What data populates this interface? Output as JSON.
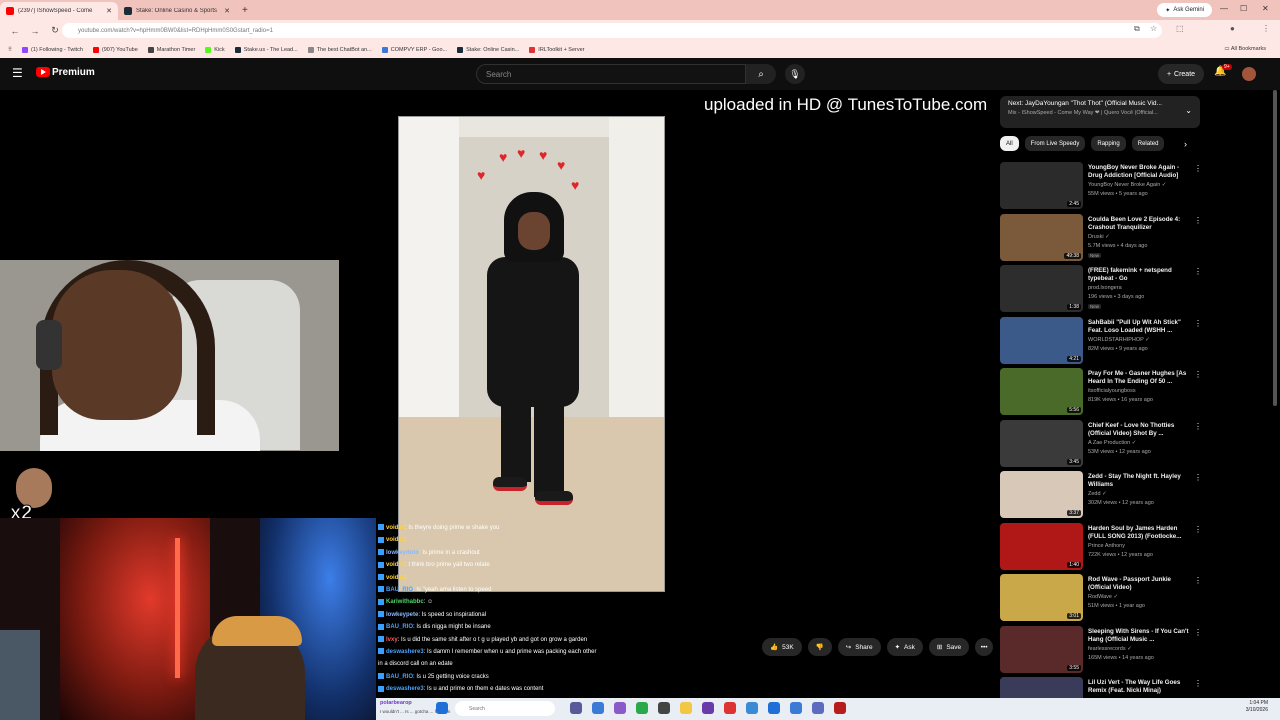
{
  "browser": {
    "tabs": [
      {
        "label": "(2397) IShowSpeed - Come",
        "active": true
      },
      {
        "label": "Stake: Online Casino & Sports",
        "active": false
      }
    ],
    "new_tab": "+",
    "ask_gemini": "Ask Gemini",
    "url": "youtube.com/watch?v=hpHmm0BW0&list=RDHpHmm0S0Gstart_radio=1",
    "bookmarks": [
      "(1) Following - Twitch",
      "(907) YouTube",
      "Marathon Timer",
      "Kick",
      "Stake.us - The Lead...",
      "The best ChatBot an...",
      "COMPVY ERP - Goo...",
      "Stake: Online Casin...",
      "IRLToolkit + Server"
    ],
    "all_bookmarks": "All Bookmarks"
  },
  "youtube": {
    "brand": "Premium",
    "search_placeholder": "Search",
    "create": "Create",
    "notifications": "9+"
  },
  "video": {
    "watermark": "uploaded in HD @ TunesToTube.com"
  },
  "actions": {
    "likes": "53K",
    "share": "Share",
    "ask": "Ask",
    "save": "Save",
    "more": "•••"
  },
  "upnext": {
    "title": "Next: JayDaYoungan \"Thot Thot\" (Official Music Vid...",
    "subtitle": "Mix - IShowSpeed - Come My Way ❤ | Quero Você (Official..."
  },
  "chips": [
    "All",
    "From Live Speedy",
    "Rapping",
    "Related"
  ],
  "recommendations": [
    {
      "title": "YoungBoy Never Broke Again - Drug Addiction [Official Audio]",
      "channel": "YoungBoy Never Broke Again ✓",
      "meta": "55M views • 5 years ago",
      "duration": "2:45",
      "new": ""
    },
    {
      "title": "Coulda Been Love 2 Episode 4: Crashout Tranquilizer",
      "channel": "Druski ✓",
      "meta": "5.7M views • 4 days ago",
      "duration": "49:38",
      "new": "New"
    },
    {
      "title": "(FREE) fakemink + netspend typebeat - Go",
      "channel": "prod.lxongera",
      "meta": "196 views • 3 days ago",
      "duration": "1:38",
      "new": "New"
    },
    {
      "title": "SahBabii \"Pull Up Wit Ah Stick\" Feat. Loso Loaded (WSHH ...",
      "channel": "WORLDSTARHIPHOP ✓",
      "meta": "82M views • 9 years ago",
      "duration": "4:21",
      "new": ""
    },
    {
      "title": "Pray For Me - Gasner Hughes [As Heard In The Ending Of 50 ...",
      "channel": "itsofficialyoungboss",
      "meta": "819K views • 16 years ago",
      "duration": "5:56",
      "new": ""
    },
    {
      "title": "Chief Keef - Love No Thotties (Official Video) Shot By ...",
      "channel": "A Zae Production ✓",
      "meta": "53M views • 12 years ago",
      "duration": "3:45",
      "new": ""
    },
    {
      "title": "Zedd - Stay The Night ft. Hayley Williams",
      "channel": "Zedd ✓",
      "meta": "302M views • 12 years ago",
      "duration": "3:37",
      "new": ""
    },
    {
      "title": "Harden Soul by James Harden (FULL SONG 2013) (Footlocke...",
      "channel": "Prince Anthony",
      "meta": "722K views • 12 years ago",
      "duration": "1:40",
      "new": ""
    },
    {
      "title": "Rod Wave - Passport Junkie (Official Video)",
      "channel": "RodWave ✓",
      "meta": "51M views • 1 year ago",
      "duration": "3:01",
      "new": ""
    },
    {
      "title": "Sleeping With Sirens - If You Can't Hang (Official Music ...",
      "channel": "fearlessrecords ✓",
      "meta": "165M views • 14 years ago",
      "duration": "3:55",
      "new": ""
    },
    {
      "title": "Lil Uzi Vert - The Way Life Goes Remix (Feat. Nicki Minaj)",
      "channel": "",
      "meta": "",
      "duration": "",
      "new": ""
    }
  ],
  "chat": [
    {
      "user": "voidxx",
      "msg": ": Is theyre doing prime w shake you",
      "color": "#ffd23a"
    },
    {
      "user": "voidxx",
      "msg": ":",
      "color": "#ffd23a"
    },
    {
      "user": "lowkeydoto",
      "msg": ": Is prime in a crashout",
      "color": "#8ab8ff"
    },
    {
      "user": "voidxx",
      "msg": ": I think bro prime yall two relate",
      "color": "#ffd23a"
    },
    {
      "user": "voidxx",
      "msg": ":",
      "color": "#ffd23a"
    },
    {
      "user": "BAU_RIO",
      "msg": ": Is \"yeah ama listen to speed",
      "color": "#4aa3ff"
    },
    {
      "user": "Kariwithabbc",
      "msg": ": ☺",
      "color": "#4cd96a"
    },
    {
      "user": "lowkeypete",
      "msg": ": Is speed so inspirational",
      "color": "#8ab8ff"
    },
    {
      "user": "BAU_RIO",
      "msg": ": Is dis nigga might be insane",
      "color": "#4aa3ff"
    },
    {
      "user": "lvxy",
      "msg": ": Is u did the same shit after o t g u played yb and got on grow a garden",
      "color": "#ff5a5a"
    },
    {
      "user": "deswashere3",
      "msg": ": Is damm I remember when u and prime was packing each other",
      "color": "#4aa3ff"
    },
    {
      "user": "",
      "msg": "in a discord call on an edate",
      "color": "#ffffff"
    },
    {
      "user": "BAU_RIO",
      "msg": ": Is u 25 getting voice cracks",
      "color": "#4aa3ff"
    },
    {
      "user": "deswashere3",
      "msg": ": Is u and prime on them e dates was content",
      "color": "#4aa3ff"
    }
  ],
  "taskbar": {
    "user": "polarbearop",
    "user_msg": "I wouldn't ... Is ... gotcha ... flags on",
    "search": "Search",
    "time": "1:04 PM",
    "date": "3/10/2026"
  },
  "overlay": {
    "emote_text": "x2"
  },
  "colors": {
    "youtube_red": "#ff0000",
    "tab_bar": "#f0c3bd"
  }
}
